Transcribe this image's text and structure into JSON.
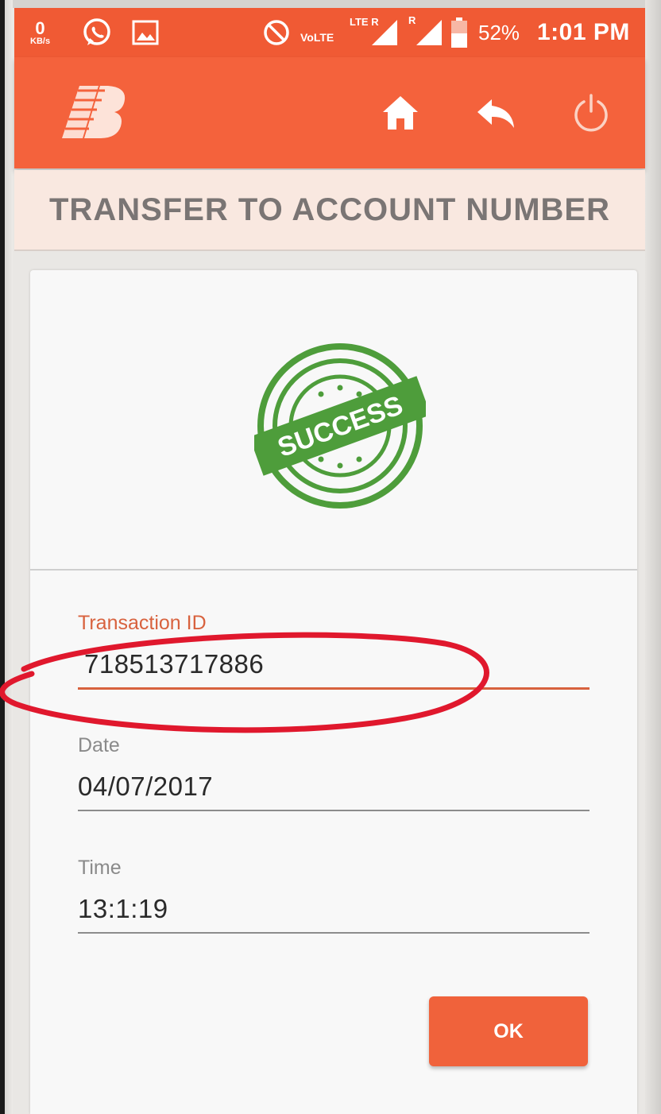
{
  "status_bar": {
    "net_speed": "0",
    "net_unit": "KB/s",
    "volte": "VoLTE",
    "lte": "LTE R",
    "roaming": "R",
    "battery": "52%",
    "time": "1:01 PM",
    "icons": [
      "whatsapp-icon",
      "gallery-icon",
      "do-not-disturb-icon",
      "signal-icon",
      "battery-icon"
    ]
  },
  "app_bar": {
    "icons": [
      "bank-logo",
      "home-icon",
      "back-icon",
      "power-icon"
    ]
  },
  "page": {
    "title": "TRANSFER TO ACCOUNT NUMBER"
  },
  "result": {
    "stamp_text": "SUCCESS",
    "stamp_color": "#4e9d3b"
  },
  "fields": {
    "transaction_id": {
      "label": "Transaction ID",
      "value": "718513717886"
    },
    "date": {
      "label": "Date",
      "value": "04/07/2017"
    },
    "time": {
      "label": "Time",
      "value": "13:1:19"
    }
  },
  "actions": {
    "ok_label": "OK"
  },
  "colors": {
    "accent": "#f4623c",
    "annotation": "#e0182d"
  }
}
